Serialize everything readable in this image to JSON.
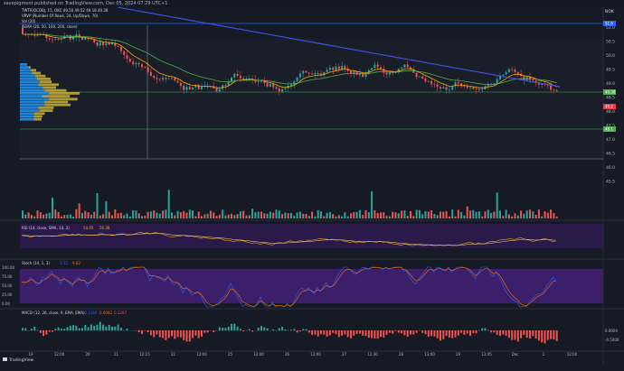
{
  "header": {
    "published": "savepigment published on TradingView.com, Dec 05, 2024 07:29 UTC+1"
  },
  "legend": {
    "symbol_line": "TWTR/OCOBJ, 15, OKC  49.50  49.52  49.18  49.38",
    "vrvp_line": "VRVP (Number Of Rows, 24, Up/Down, 70)",
    "vol_line": "Vol (20)",
    "ema_line": "4EMA (20, 50, 100, 200, close)"
  },
  "price_axis": {
    "unit": "NOK",
    "ticks": [
      "51.0",
      "50.5",
      "50.0",
      "49.5",
      "49.0",
      "48.5",
      "48.0",
      "47.5",
      "47.0",
      "46.5",
      "46.0",
      "45.5"
    ],
    "badges": [
      {
        "value": "51.6",
        "color": "#2962ff"
      },
      {
        "value": "49.38",
        "color": "#4caf50"
      },
      {
        "value": "49.2",
        "color": "#f23645"
      },
      {
        "value": "48.1",
        "color": "#4caf50"
      }
    ]
  },
  "rsi": {
    "label": "RSI (14, close, SMA, 14, 2)",
    "v1": "54.95",
    "v2": "56.38",
    "color": "#7e57c2"
  },
  "stoch": {
    "label": "Stoch (14, 1, 3)",
    "v1": "3.12",
    "v2": "9.82",
    "ticks": [
      "100.00",
      "75.00",
      "50.00",
      "25.00",
      "0.00"
    ]
  },
  "macd": {
    "label": "MACD (12, 26, close, 9, EMA, EMA)",
    "v1": "-0.1169",
    "v2": "0.0042",
    "v3": "0.1207",
    "ticks": [
      "0.0000",
      "-0.5000"
    ]
  },
  "time_axis": {
    "ticks": [
      "19",
      "12:00",
      "20",
      "21",
      "12:15",
      "22",
      "12:00",
      "25",
      "12:00",
      "26",
      "12:00",
      "27",
      "12:30",
      "28",
      "13:00",
      "29",
      "13:45",
      "Dec",
      "2",
      "12:00"
    ]
  },
  "logo": "TradingView",
  "colors": {
    "bg": "#161a25",
    "up": "#26a69a",
    "down": "#ef5350",
    "ema20": "#f7a600",
    "ema50": "#4caf50",
    "ema200": "#3f51d8",
    "vrvp_up": "#2196f3",
    "vrvp_down": "#c9b037",
    "stoch_k": "#2962ff",
    "stoch_d": "#ff6d00"
  }
}
